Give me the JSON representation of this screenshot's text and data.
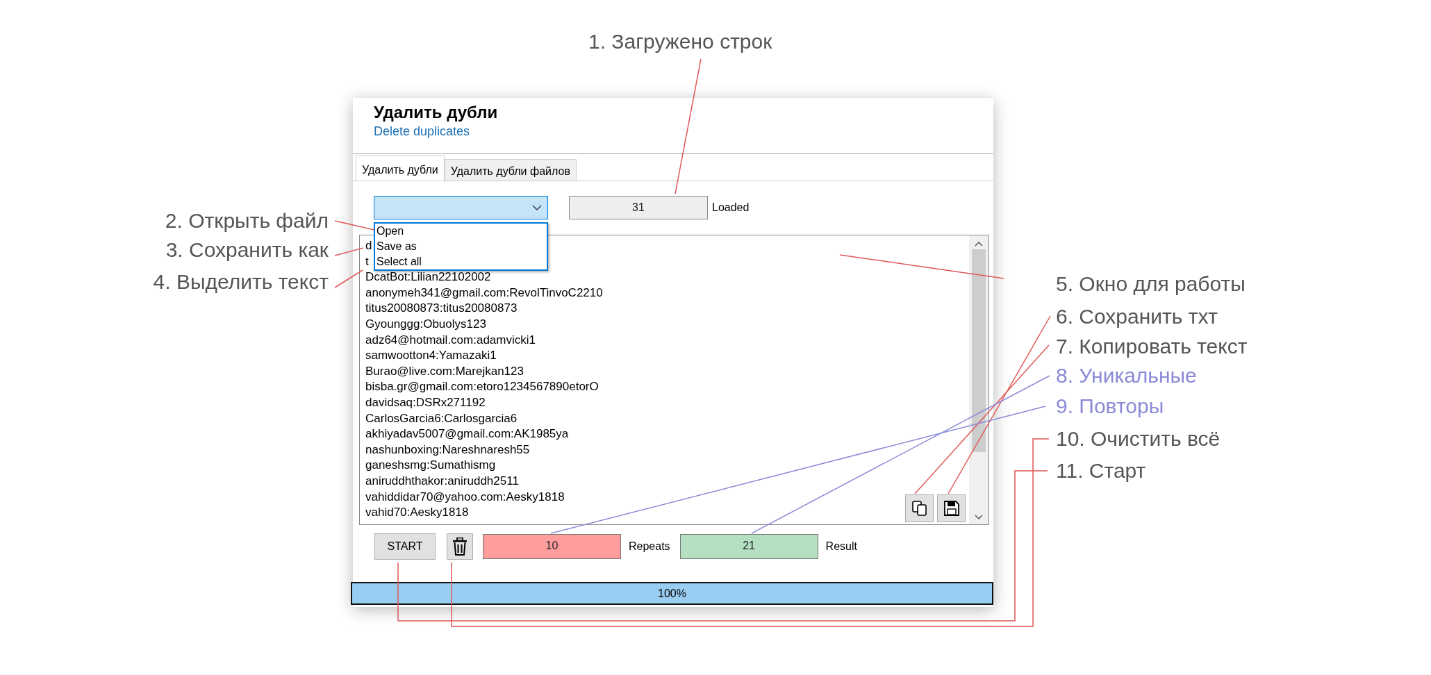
{
  "annotations": [
    {
      "text": "1. Загружено строк",
      "color": "#e05858"
    },
    {
      "text": "2. Открыть файл",
      "color": "#e05858"
    },
    {
      "text": "3. Сохранить как",
      "color": "#e05858"
    },
    {
      "text": "4. Выделить текст",
      "color": "#e05858"
    },
    {
      "text": "5. Окно для работы",
      "color": "#e05858"
    },
    {
      "text": "6. Сохранить тхт",
      "color": "#e05858"
    },
    {
      "text": "7. Копировать текст",
      "color": "#e05858"
    },
    {
      "text": "8. Уникальные",
      "color": "#8a8ad8"
    },
    {
      "text": "9. Повторы",
      "color": "#8a8ad8"
    },
    {
      "text": "10. Очистить всё",
      "color": "#e05858"
    },
    {
      "text": "11. Старт",
      "color": "#e05858"
    }
  ],
  "window": {
    "title": "Удалить дубли",
    "subtitle": "Delete duplicates"
  },
  "tabs": [
    {
      "label": "Удалить дубли",
      "selected": true
    },
    {
      "label": "Удалить дубли файлов",
      "selected": false
    }
  ],
  "action_dropdown": {
    "expanded": true,
    "items": [
      "Open",
      "Save as",
      "Select all"
    ]
  },
  "loaded": {
    "value": "31",
    "label": "Loaded"
  },
  "text_lines": [
    "d",
    "t",
    "DcatBot:Lilian22102002",
    "anonymeh341@gmail.com:RevolTinvoC2210",
    "titus20080873:titus20080873",
    "Gyounggg:Obuolys123",
    "adz64@hotmail.com:adamvicki1",
    "samwootton4:Yamazaki1",
    "Burao@live.com:Marejkan123",
    "bisba.gr@gmail.com:etoro1234567890etorO",
    "davidsaq:DSRx271192",
    "CarlosGarcia6:Carlosgarcia6",
    "akhiyadav5007@gmail.com:AK1985ya",
    "nashunboxing:Nareshnaresh55",
    "ganeshsmg:Sumathismg",
    "aniruddhthakor:aniruddh2511",
    "vahiddidar70@yahoo.com:Aesky1818",
    "vahid70:Aesky1818"
  ],
  "start_button": "START",
  "repeats": {
    "value": "10",
    "label": "Repeats"
  },
  "result": {
    "value": "21",
    "label": "Result"
  },
  "progress": {
    "level": 1,
    "text": "100%"
  }
}
